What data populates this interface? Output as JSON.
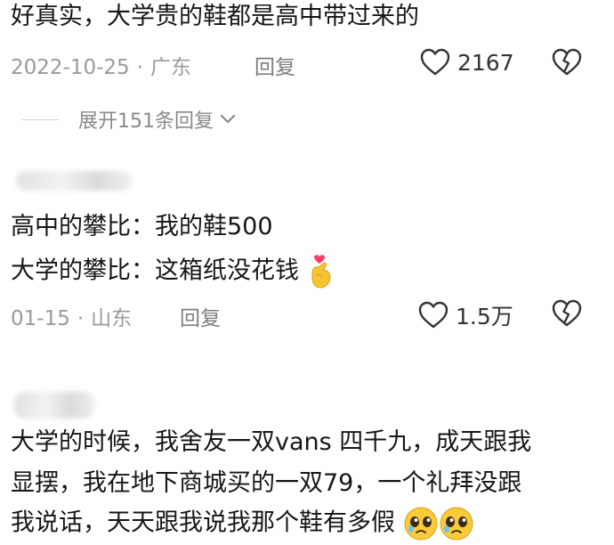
{
  "colors": {
    "text": "#161616",
    "meta": "#9a9a9a",
    "heart_emoji": "#ff3d6b",
    "hand_emoji": "#f7c431"
  },
  "comments": [
    {
      "lines": [
        "好真实，大学贵的鞋都是高中带过来的"
      ],
      "date": "2022-10-25",
      "separator": "·",
      "location": "广东",
      "reply_label": "回复",
      "likes": "2167",
      "like_icon": "heart-outline-icon",
      "dislike_icon": "broken-heart-icon"
    },
    {
      "lines": [
        "高中的攀比：我的鞋500",
        "大学的攀比：这箱纸没花钱"
      ],
      "emoji": "finger-heart-emoji",
      "date": "01-15",
      "separator": "·",
      "location": "山东",
      "reply_label": "回复",
      "likes": "1.5万",
      "like_icon": "heart-outline-icon",
      "dislike_icon": "broken-heart-icon"
    },
    {
      "lines": [
        "大学的时候，我舍友一双vans 四千九，成天跟我",
        "显摆，我在地下商城买的一双79，一个礼拜没跟",
        "我说话，天天跟我说我那个鞋有多假"
      ],
      "emoji": "pleading-face-emoji"
    }
  ],
  "expand_replies": {
    "label": "展开151条回复",
    "icon": "chevron-down-icon"
  }
}
